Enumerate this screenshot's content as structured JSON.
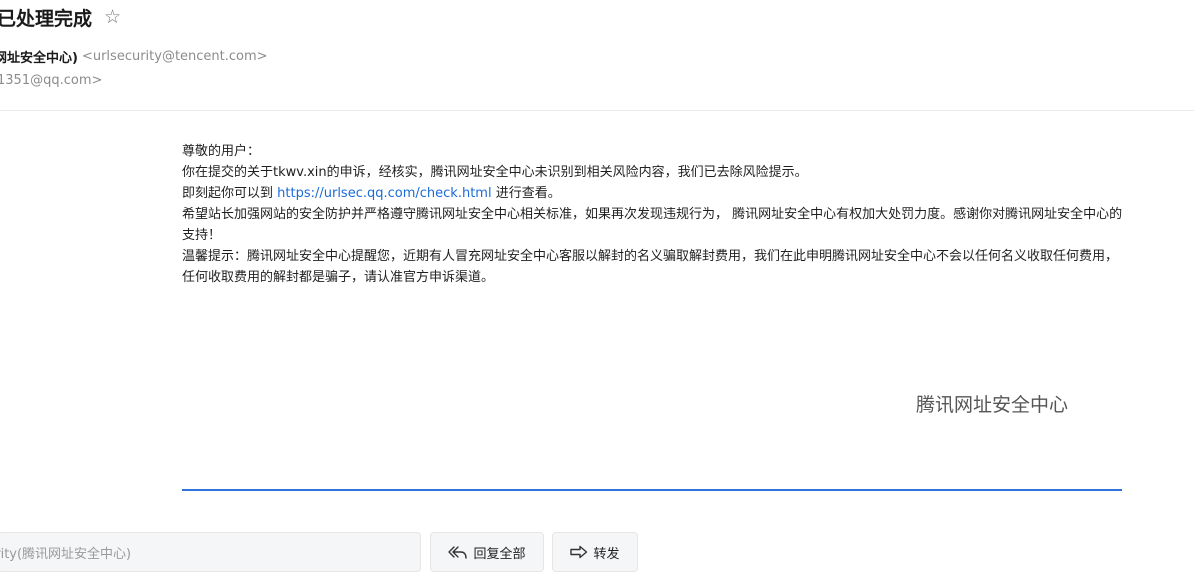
{
  "header": {
    "subject": "已处理完成",
    "star_icon": "star-outline-icon",
    "from_name": "网址安全中心)",
    "from_email": "<urlsecurity@tencent.com>",
    "to_email": "1351@qq.com>"
  },
  "body": {
    "greeting": "尊敬的用户：",
    "line1": "你在提交的关于tkwv.xin的申诉，经核实，腾讯网址安全中心未识别到相关风险内容，我们已去除风险提示。",
    "line2_before": "即刻起你可以到 ",
    "line2_link": "https://urlsec.qq.com/check.html",
    "line2_after": " 进行查看。",
    "line3": "希望站长加强网站的安全防护并严格遵守腾讯网址安全中心相关标准，如果再次发现违规行为， 腾讯网址安全中心有权加大处罚力度。感谢你对腾讯网址安全中心的支持！",
    "line4": "温馨提示：腾讯网址安全中心提醒您，近期有人冒充网址安全中心客服以解封的名义骗取解封费用，我们在此申明腾讯网址安全中心不会以任何名义收取任何费用，任何收取费用的解封都是骗子，请认准官方申诉渠道。",
    "signature": "腾讯网址安全中心"
  },
  "reply_bar": {
    "reply_placeholder": "urity(腾讯网址安全中心)",
    "reply_all_label": "回复全部",
    "reply_all_icon": "reply-all-icon",
    "forward_label": "转发",
    "forward_icon": "forward-icon"
  },
  "colors": {
    "link": "#1a6cd8",
    "divider": "#2f74dc"
  }
}
